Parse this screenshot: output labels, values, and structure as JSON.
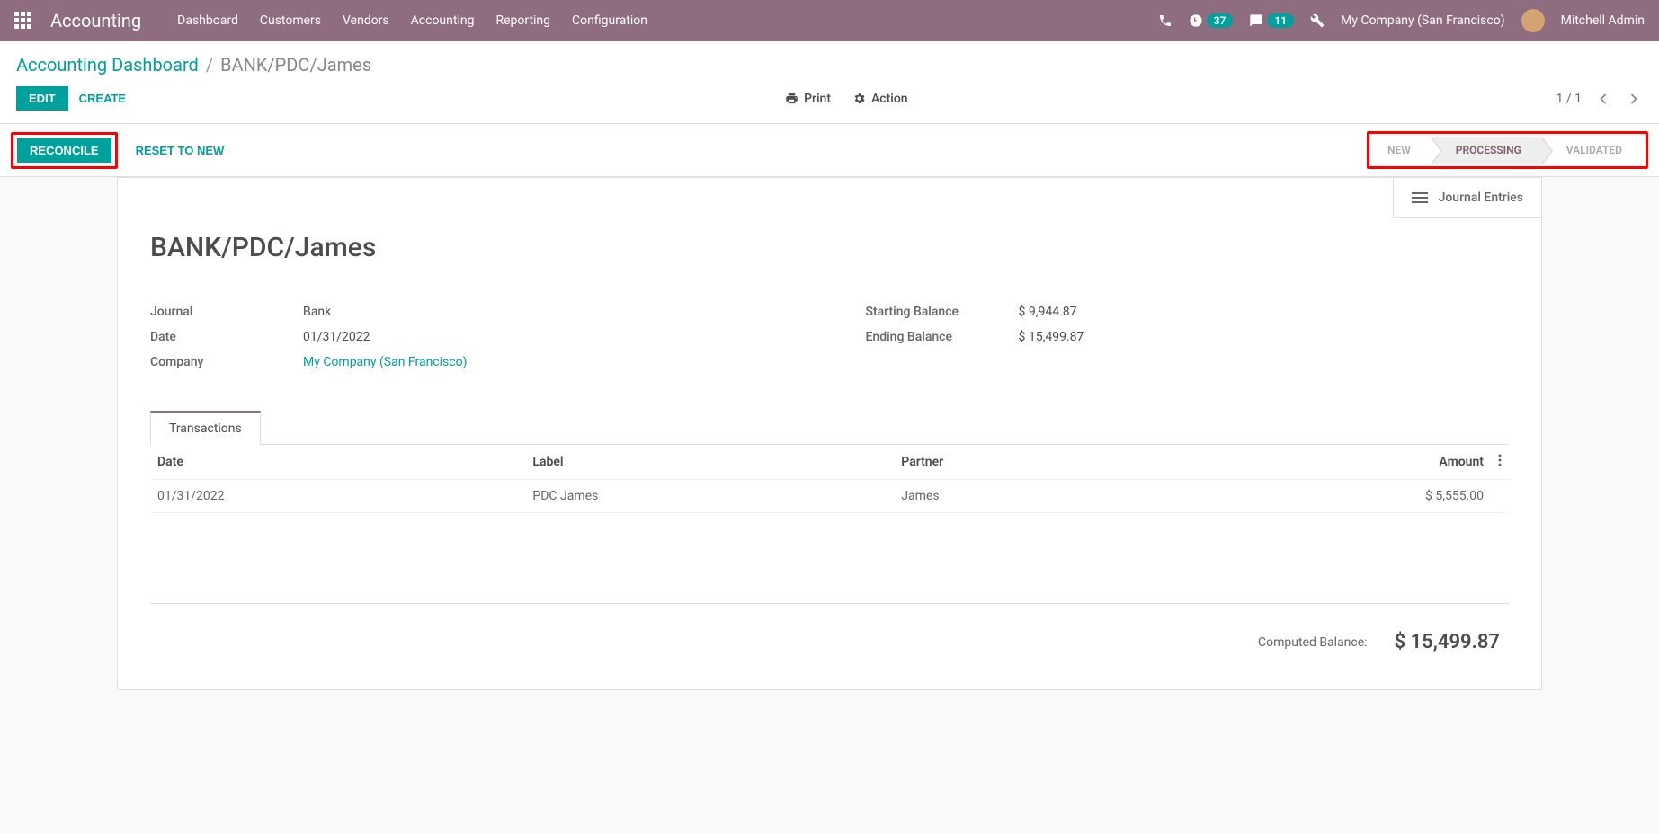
{
  "navbar": {
    "brand": "Accounting",
    "links": [
      "Dashboard",
      "Customers",
      "Vendors",
      "Accounting",
      "Reporting",
      "Configuration"
    ],
    "badge_activity": "37",
    "badge_discuss": "11",
    "company": "My Company (San Francisco)",
    "user": "Mitchell Admin"
  },
  "breadcrumb": {
    "parent": "Accounting Dashboard",
    "current": "BANK/PDC/James"
  },
  "actions": {
    "edit": "EDIT",
    "create": "CREATE",
    "print": "Print",
    "action": "Action",
    "pager": "1 / 1"
  },
  "status_bar": {
    "reconcile": "RECONCILE",
    "reset": "RESET TO NEW",
    "steps": {
      "new": "NEW",
      "processing": "PROCESSING",
      "validated": "VALIDATED"
    }
  },
  "card": {
    "journal_entries": "Journal Entries",
    "title": "BANK/PDC/James",
    "fields_left": {
      "journal_label": "Journal",
      "journal_value": "Bank",
      "date_label": "Date",
      "date_value": "01/31/2022",
      "company_label": "Company",
      "company_value": "My Company (San Francisco)"
    },
    "fields_right": {
      "start_label": "Starting Balance",
      "start_value": "$ 9,944.87",
      "end_label": "Ending Balance",
      "end_value": "$ 15,499.87"
    },
    "tab": "Transactions",
    "table": {
      "headers": {
        "date": "Date",
        "label": "Label",
        "partner": "Partner",
        "amount": "Amount"
      },
      "row": {
        "date": "01/31/2022",
        "label": "PDC James",
        "partner": "James",
        "amount": "$ 5,555.00"
      }
    },
    "computed_label": "Computed Balance:",
    "computed_value": "$ 15,499.87"
  }
}
